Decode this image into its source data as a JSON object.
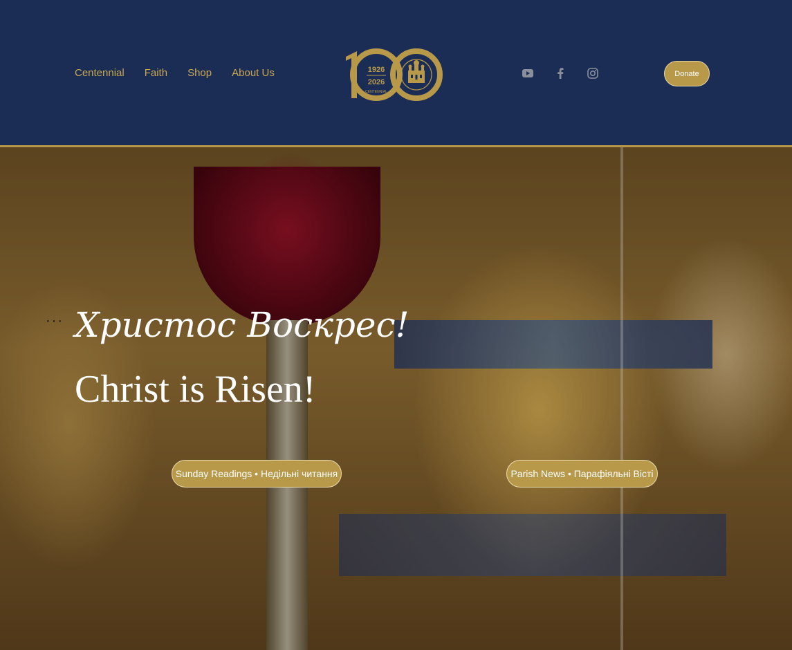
{
  "nav": {
    "items": [
      {
        "label": "Centennial"
      },
      {
        "label": "Faith"
      },
      {
        "label": "Shop"
      },
      {
        "label": "About Us"
      }
    ]
  },
  "logo": {
    "year_start": "1926",
    "year_end": "2026",
    "ribbon": "CENTENNIAL",
    "ring_text": "ST. VOLODYMYR CATHEDRAL"
  },
  "social": {
    "icons": [
      "youtube-icon",
      "facebook-icon",
      "instagram-icon"
    ]
  },
  "donate": {
    "label": "Donate"
  },
  "hero": {
    "title_ua": "Христос Воскрес!",
    "title_en": "Christ is Risen!",
    "dots": "···",
    "buttons": {
      "readings": "Sunday Readings • Недільні читання",
      "news": "Parish News • Парафіяльні Вісті"
    }
  },
  "colors": {
    "navy": "#1b2d55",
    "gold": "#b8994a",
    "nav_text": "#c9a851"
  }
}
